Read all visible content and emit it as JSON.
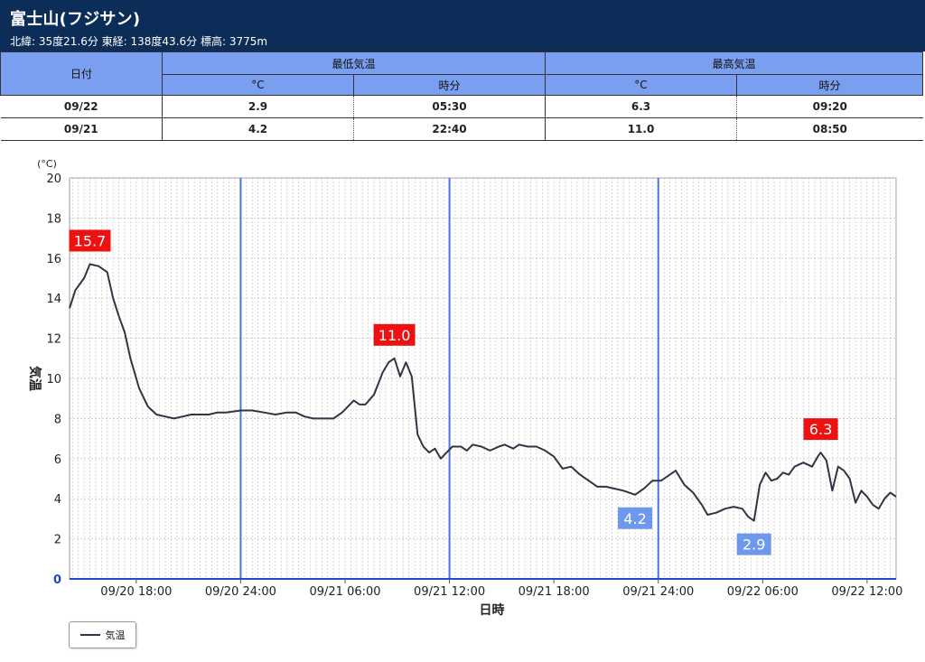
{
  "header": {
    "title": "富士山(フジサン)",
    "meta": "北緯: 35度21.6分 東経: 138度43.6分 標高: 3775m"
  },
  "table": {
    "date_header": "日付",
    "min_header": "最低気温",
    "max_header": "最高気温",
    "sub_temp": "°C",
    "sub_time": "時分",
    "rows": [
      {
        "date": "09/22",
        "min_temp": "2.9",
        "min_time": "05:30",
        "max_temp": "6.3",
        "max_time": "09:20"
      },
      {
        "date": "09/21",
        "min_temp": "4.2",
        "min_time": "22:40",
        "max_temp": "11.0",
        "max_time": "08:50"
      }
    ]
  },
  "legend": {
    "label": "気温"
  },
  "colors": {
    "header_bg": "#0c2d57",
    "table_head": "#7b9ff0",
    "line": "#333344",
    "max_label": "#ee1111",
    "min_label": "#6e98ec",
    "day_line": "#4a72e0"
  },
  "chart_data": {
    "type": "line",
    "ylabel": "気温",
    "yunit": "(°C)",
    "xlabel": "日時",
    "ylim": [
      0,
      20
    ],
    "yticks": [
      "0",
      "2",
      "4",
      "6",
      "8",
      "10",
      "12",
      "14",
      "16",
      "18",
      "20"
    ],
    "xlim": [
      "09/20 14:10",
      "09/22 13:40"
    ],
    "xticks": [
      {
        "t": "09/20 18:00",
        "label": "09/20 18:00"
      },
      {
        "t": "09/21 00:00",
        "label": "09/20 24:00"
      },
      {
        "t": "09/21 06:00",
        "label": "09/21 06:00"
      },
      {
        "t": "09/21 12:00",
        "label": "09/21 12:00"
      },
      {
        "t": "09/21 18:00",
        "label": "09/21 18:00"
      },
      {
        "t": "09/22 00:00",
        "label": "09/21 24:00"
      },
      {
        "t": "09/22 06:00",
        "label": "09/22 06:00"
      },
      {
        "t": "09/22 12:00",
        "label": "09/22 12:00"
      }
    ],
    "grid": true,
    "series": [
      {
        "name": "気温",
        "points": [
          [
            "09/20 14:10",
            13.5
          ],
          [
            "09/20 14:30",
            14.4
          ],
          [
            "09/20 15:00",
            15.0
          ],
          [
            "09/20 15:20",
            15.7
          ],
          [
            "09/20 15:50",
            15.6
          ],
          [
            "09/20 16:20",
            15.3
          ],
          [
            "09/20 16:40",
            14.0
          ],
          [
            "09/20 17:00",
            13.1
          ],
          [
            "09/20 17:20",
            12.3
          ],
          [
            "09/20 17:40",
            11.0
          ],
          [
            "09/20 18:10",
            9.5
          ],
          [
            "09/20 18:40",
            8.6
          ],
          [
            "09/20 19:10",
            8.2
          ],
          [
            "09/20 19:40",
            8.1
          ],
          [
            "09/20 20:10",
            8.0
          ],
          [
            "09/20 20:40",
            8.1
          ],
          [
            "09/20 21:10",
            8.2
          ],
          [
            "09/20 21:40",
            8.2
          ],
          [
            "09/20 22:10",
            8.2
          ],
          [
            "09/20 22:40",
            8.3
          ],
          [
            "09/20 23:10",
            8.3
          ],
          [
            "09/21 00:00",
            8.4
          ],
          [
            "09/21 00:40",
            8.4
          ],
          [
            "09/21 01:20",
            8.3
          ],
          [
            "09/21 02:00",
            8.2
          ],
          [
            "09/21 02:40",
            8.3
          ],
          [
            "09/21 03:10",
            8.3
          ],
          [
            "09/21 03:40",
            8.1
          ],
          [
            "09/21 04:10",
            8.0
          ],
          [
            "09/21 04:40",
            8.0
          ],
          [
            "09/21 05:20",
            8.0
          ],
          [
            "09/21 05:50",
            8.3
          ],
          [
            "09/21 06:10",
            8.6
          ],
          [
            "09/21 06:30",
            8.9
          ],
          [
            "09/21 06:50",
            8.7
          ],
          [
            "09/21 07:10",
            8.7
          ],
          [
            "09/21 07:40",
            9.2
          ],
          [
            "09/21 08:10",
            10.3
          ],
          [
            "09/21 08:30",
            10.8
          ],
          [
            "09/21 08:50",
            11.0
          ],
          [
            "09/21 09:10",
            10.1
          ],
          [
            "09/21 09:30",
            10.8
          ],
          [
            "09/21 09:50",
            10.1
          ],
          [
            "09/21 10:10",
            7.2
          ],
          [
            "09/21 10:30",
            6.6
          ],
          [
            "09/21 10:50",
            6.3
          ],
          [
            "09/21 11:10",
            6.5
          ],
          [
            "09/21 11:30",
            6.0
          ],
          [
            "09/21 11:50",
            6.3
          ],
          [
            "09/21 12:10",
            6.6
          ],
          [
            "09/21 12:40",
            6.6
          ],
          [
            "09/21 13:00",
            6.4
          ],
          [
            "09/21 13:20",
            6.7
          ],
          [
            "09/21 13:50",
            6.6
          ],
          [
            "09/21 14:20",
            6.4
          ],
          [
            "09/21 14:50",
            6.6
          ],
          [
            "09/21 15:10",
            6.7
          ],
          [
            "09/21 15:40",
            6.5
          ],
          [
            "09/21 16:00",
            6.7
          ],
          [
            "09/21 16:30",
            6.6
          ],
          [
            "09/21 17:00",
            6.6
          ],
          [
            "09/21 17:30",
            6.4
          ],
          [
            "09/21 18:00",
            6.1
          ],
          [
            "09/21 18:30",
            5.5
          ],
          [
            "09/21 19:00",
            5.6
          ],
          [
            "09/21 19:30",
            5.2
          ],
          [
            "09/21 20:00",
            4.9
          ],
          [
            "09/21 20:30",
            4.6
          ],
          [
            "09/21 21:00",
            4.6
          ],
          [
            "09/21 21:30",
            4.5
          ],
          [
            "09/21 22:00",
            4.4
          ],
          [
            "09/21 22:40",
            4.2
          ],
          [
            "09/21 23:10",
            4.5
          ],
          [
            "09/21 23:40",
            4.9
          ],
          [
            "09/22 00:10",
            4.9
          ],
          [
            "09/22 00:40",
            5.2
          ],
          [
            "09/22 01:00",
            5.4
          ],
          [
            "09/22 01:30",
            4.7
          ],
          [
            "09/22 02:00",
            4.3
          ],
          [
            "09/22 02:30",
            3.7
          ],
          [
            "09/22 02:50",
            3.2
          ],
          [
            "09/22 03:20",
            3.3
          ],
          [
            "09/22 03:50",
            3.5
          ],
          [
            "09/22 04:20",
            3.6
          ],
          [
            "09/22 04:50",
            3.5
          ],
          [
            "09/22 05:10",
            3.1
          ],
          [
            "09/22 05:30",
            2.9
          ],
          [
            "09/22 05:50",
            4.7
          ],
          [
            "09/22 06:10",
            5.3
          ],
          [
            "09/22 06:30",
            4.9
          ],
          [
            "09/22 06:50",
            5.0
          ],
          [
            "09/22 07:10",
            5.3
          ],
          [
            "09/22 07:30",
            5.2
          ],
          [
            "09/22 07:50",
            5.6
          ],
          [
            "09/22 08:20",
            5.8
          ],
          [
            "09/22 08:50",
            5.6
          ],
          [
            "09/22 09:10",
            6.1
          ],
          [
            "09/22 09:20",
            6.3
          ],
          [
            "09/22 09:40",
            5.9
          ],
          [
            "09/22 10:00",
            4.4
          ],
          [
            "09/22 10:20",
            5.6
          ],
          [
            "09/22 10:40",
            5.4
          ],
          [
            "09/22 11:00",
            5.0
          ],
          [
            "09/22 11:20",
            3.8
          ],
          [
            "09/22 11:40",
            4.4
          ],
          [
            "09/22 12:00",
            4.1
          ],
          [
            "09/22 12:20",
            3.7
          ],
          [
            "09/22 12:40",
            3.5
          ],
          [
            "09/22 13:00",
            4.0
          ],
          [
            "09/22 13:20",
            4.3
          ],
          [
            "09/22 13:40",
            4.1
          ]
        ]
      }
    ],
    "annotations": [
      {
        "t": "09/20 15:20",
        "y": 15.7,
        "text": "15.7",
        "kind": "max"
      },
      {
        "t": "09/21 08:50",
        "y": 11.0,
        "text": "11.0",
        "kind": "max"
      },
      {
        "t": "09/21 22:40",
        "y": 4.2,
        "text": "4.2",
        "kind": "min"
      },
      {
        "t": "09/22 05:30",
        "y": 2.9,
        "text": "2.9",
        "kind": "min"
      },
      {
        "t": "09/22 09:20",
        "y": 6.3,
        "text": "6.3",
        "kind": "max"
      }
    ]
  }
}
